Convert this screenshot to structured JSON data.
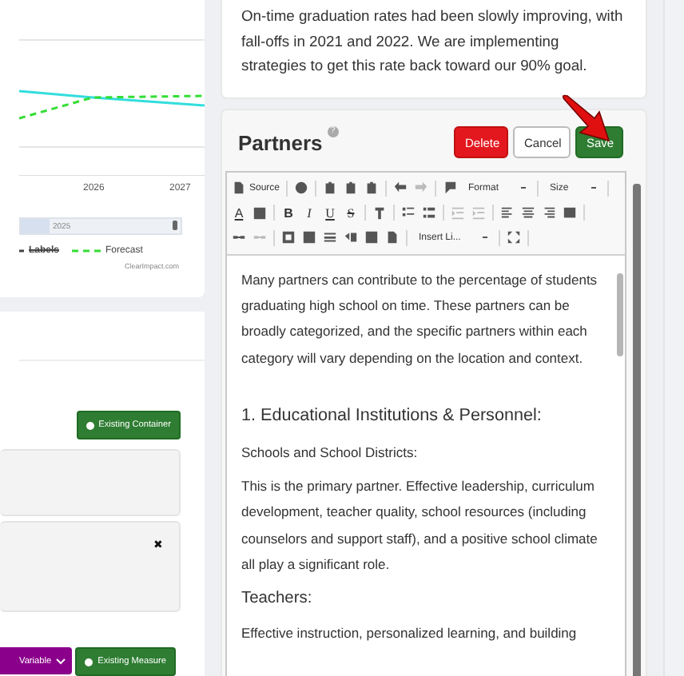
{
  "chart": {
    "x_labels": [
      "2026",
      "2027"
    ],
    "navigator_label": "2025",
    "legend": [
      {
        "label": "Labels",
        "hidden": true,
        "color": "#444444"
      },
      {
        "label": "Forecast",
        "hidden": false,
        "color": "#33dd33"
      }
    ],
    "credit": "ClearImpact.com"
  },
  "left_panel": {
    "add_container": "Existing Container",
    "close": "✖",
    "variable_button": "Variable",
    "add_measure": "Existing Measure"
  },
  "description": "On-time graduation rates had been slowly improving, with fall-offs in 2021 and 2022. We are implementing strategies to get this rate back toward our 90% goal.",
  "partners": {
    "title": "Partners",
    "help": "?",
    "buttons": [
      {
        "label": "Delete",
        "kind": "danger"
      },
      {
        "label": "Cancel",
        "kind": "default"
      },
      {
        "label": "Save",
        "kind": "primary"
      }
    ],
    "toolbar": {
      "source": "Source",
      "format": "Format",
      "size": "Size",
      "text_color": "A",
      "bold": "B",
      "italic": "I",
      "underline": "U",
      "strike": "S",
      "insert": "Insert Li..."
    },
    "content": [
      {
        "kind": "paragraph",
        "text": "Many partners can contribute to the percentage of students graduating high school on time. These partners can be broadly categorized, and the specific partners within each category will vary depending on the location and context."
      },
      {
        "kind": "heading",
        "text": "1. Educational Institutions & Personnel:"
      },
      {
        "kind": "paragraph",
        "text": "Schools and School Districts:"
      },
      {
        "kind": "paragraph",
        "text": "This is the primary partner. Effective leadership, curriculum development, teacher quality, school resources (including counselors and support staff), and a positive school climate all play a significant role."
      },
      {
        "kind": "subheading",
        "text": "Teachers:"
      },
      {
        "kind": "paragraph",
        "text": "Effective instruction, personalized learning, and building"
      }
    ]
  }
}
